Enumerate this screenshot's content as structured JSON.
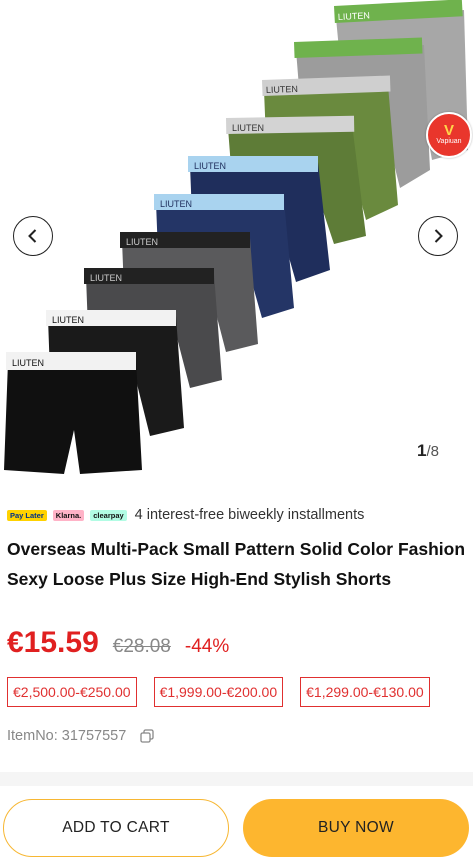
{
  "gallery": {
    "current": "1",
    "total": "/8",
    "badge_text": "Vapiuan",
    "badge_letter": "V",
    "brand_label": "LIUTEN",
    "colors": {
      "grey_band": "#6fb24d",
      "grey_body": "#a7a7a7",
      "green_body": "#5e7c37",
      "green_band_1": "#d3d3d3",
      "navy_body": "#1f2e5c",
      "navy_band": "#a9d3ef",
      "charcoal_body": "#5a5a5c",
      "black_band": "#222222",
      "black_body": "#101010",
      "white_band": "#f2f2f2"
    }
  },
  "payment": {
    "logos": [
      "Pay Later",
      "Klarna.",
      "clearpay"
    ],
    "text": "4 interest-free biweekly installments"
  },
  "product": {
    "title": "Overseas Multi-Pack Small Pattern Solid Color Fashion Sexy Loose Plus Size High-End Stylish Shorts",
    "price": "€15.59",
    "original_price": "€28.08",
    "discount": "-44%",
    "coupons": [
      "€2,500.00-€250.00",
      "€1,999.00-€200.00",
      "€1,299.00-€130.00"
    ],
    "item_no": "ItemNo: 31757557"
  },
  "actions": {
    "add_to_cart": "ADD TO CART",
    "buy_now": "BUY NOW"
  }
}
